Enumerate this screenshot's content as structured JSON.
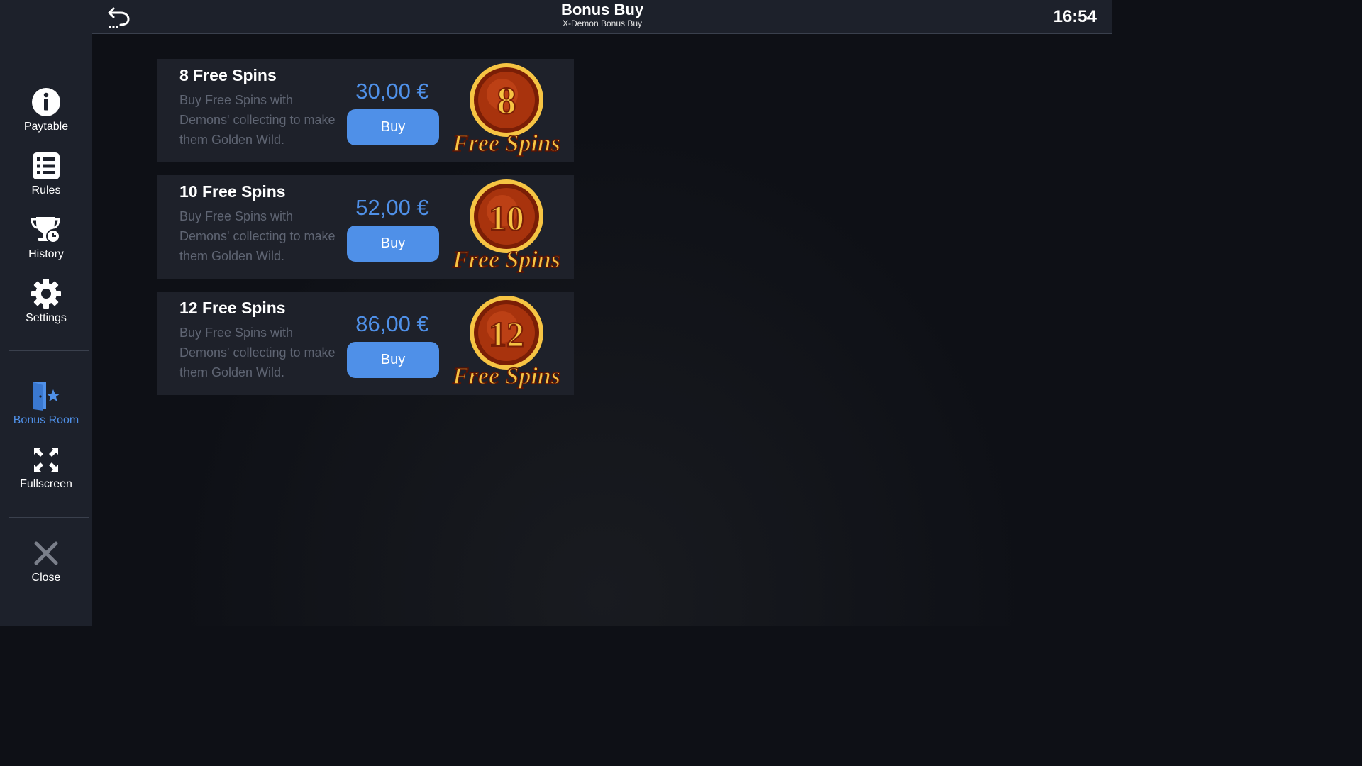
{
  "header": {
    "title": "Bonus Buy",
    "subtitle": "X-Demon Bonus Buy",
    "clock": "16:54"
  },
  "sidebar": {
    "items": [
      {
        "label": "Paytable",
        "icon": "info-icon"
      },
      {
        "label": "Rules",
        "icon": "list-icon"
      },
      {
        "label": "History",
        "icon": "trophy-clock-icon"
      },
      {
        "label": "Settings",
        "icon": "gear-icon"
      },
      {
        "label": "Bonus Room",
        "icon": "door-star-icon",
        "active": true
      },
      {
        "label": "Fullscreen",
        "icon": "fullscreen-icon"
      },
      {
        "label": "Close",
        "icon": "close-icon"
      }
    ]
  },
  "offers": [
    {
      "title": "8 Free Spins",
      "description": "Buy Free Spins with Demons' collecting to make them Golden Wild.",
      "price": "30,00 €",
      "buy_label": "Buy",
      "badge_number": "8",
      "badge_text": "Free Spins"
    },
    {
      "title": "10 Free Spins",
      "description": "Buy Free Spins with Demons' collecting to make them Golden Wild.",
      "price": "52,00 €",
      "buy_label": "Buy",
      "badge_number": "10",
      "badge_text": "Free Spins"
    },
    {
      "title": "12 Free Spins",
      "description": "Buy Free Spins with Demons' collecting to make them Golden Wild.",
      "price": "86,00 €",
      "buy_label": "Buy",
      "badge_number": "12",
      "badge_text": "Free Spins"
    }
  ],
  "colors": {
    "accent": "#4f90e8",
    "sidebar_bg": "#1d212b",
    "card_bg": "#1e212a",
    "badge_gold": "#f6c443",
    "badge_red": "#a8330d"
  }
}
